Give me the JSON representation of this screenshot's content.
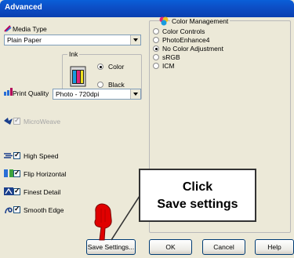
{
  "window": {
    "title": "Advanced"
  },
  "media": {
    "label": "Media Type",
    "value": "Plain Paper"
  },
  "ink": {
    "label": "Ink",
    "options": [
      {
        "label": "Color",
        "selected": true
      },
      {
        "label": "Black",
        "selected": false
      }
    ]
  },
  "print_quality": {
    "label": "Print Quality",
    "value": "Photo - 720dpi"
  },
  "options": {
    "microweave": {
      "label": "MicroWeave",
      "checked": true,
      "enabled": false
    },
    "high_speed": {
      "label": "High Speed",
      "checked": true
    },
    "flip_horizontal": {
      "label": "Flip Horizontal",
      "checked": true
    },
    "finest_detail": {
      "label": "Finest Detail",
      "checked": true
    },
    "smooth_edge": {
      "label": "Smooth Edge",
      "checked": true
    }
  },
  "color_management": {
    "title": "Color Management",
    "options": [
      {
        "label": "Color Controls",
        "selected": false
      },
      {
        "label": "PhotoEnhance4",
        "selected": false
      },
      {
        "label": "No Color Adjustment",
        "selected": true
      },
      {
        "label": "sRGB",
        "selected": false
      },
      {
        "label": "ICM",
        "selected": false
      }
    ]
  },
  "buttons": {
    "save_settings": "Save Settings...",
    "ok": "OK",
    "cancel": "Cancel",
    "help": "Help"
  },
  "annotation": {
    "line1": "Click",
    "line2": "Save settings"
  },
  "colors": {
    "titlebar": "#0c4fc7",
    "panel": "#ece9d8",
    "arrow": "#e00000",
    "callout_border": "#333333"
  }
}
